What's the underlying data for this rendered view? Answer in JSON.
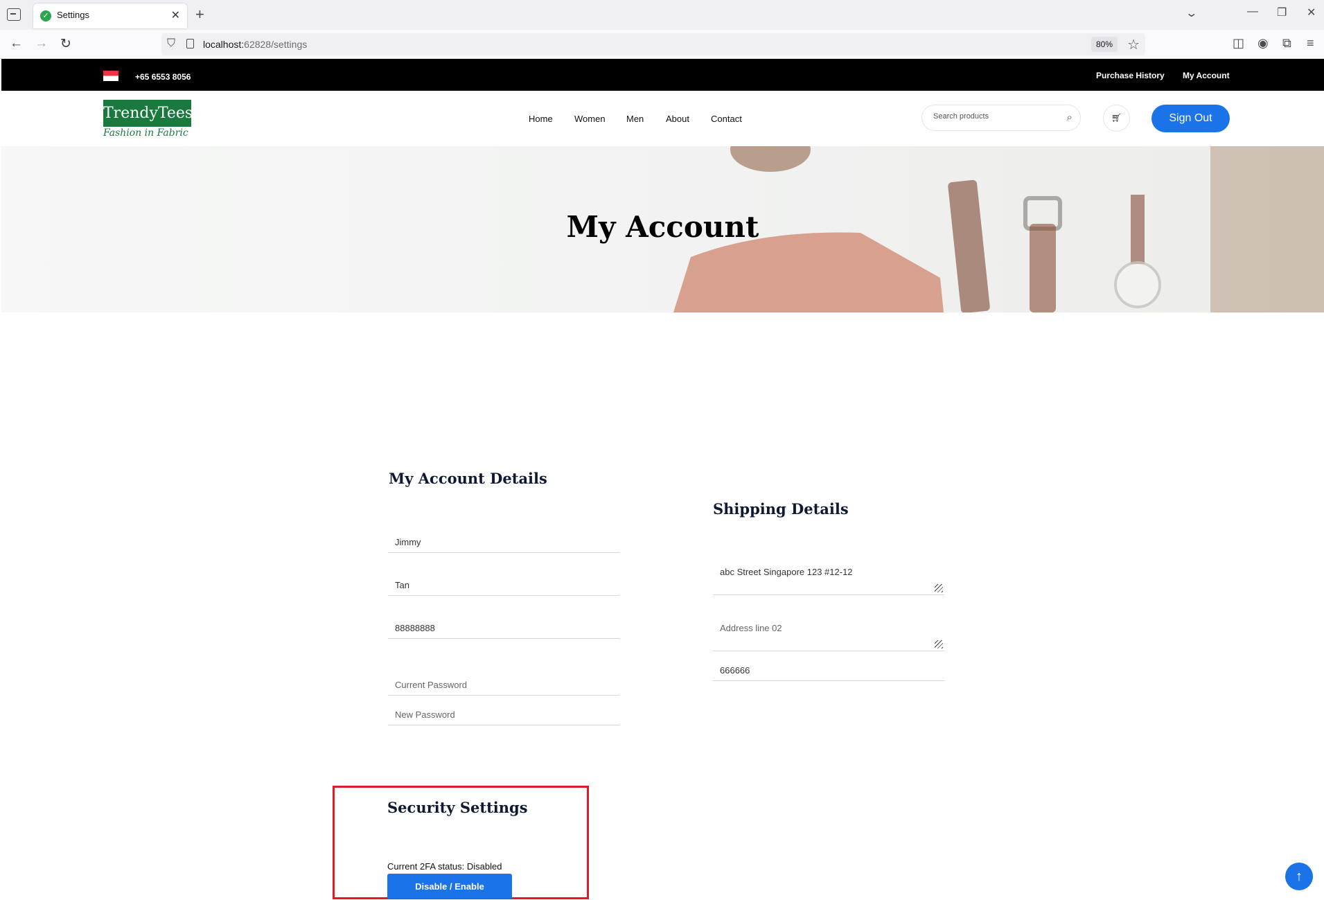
{
  "browser": {
    "tab_title": "Settings",
    "url_host": "localhost:",
    "url_path": "62828/settings",
    "zoom": "80%"
  },
  "topbar": {
    "phone": "+65 6553 8056",
    "links": [
      "Purchase History",
      "My Account"
    ]
  },
  "header": {
    "logo_name": "TrendyTees",
    "logo_tagline": "Fashion in Fabric",
    "menu": [
      "Home",
      "Women",
      "Men",
      "About",
      "Contact"
    ],
    "search_placeholder": "Search products",
    "signout_label": "Sign Out"
  },
  "hero": {
    "title": "My Account"
  },
  "account": {
    "title": "My Account Details",
    "first_name": "Jimmy",
    "last_name": "Tan",
    "phone": "88888888",
    "current_password_placeholder": "Current Password",
    "new_password_placeholder": "New Password"
  },
  "shipping": {
    "title": "Shipping Details",
    "address1": "abc Street Singapore 123 #12-12",
    "address2_placeholder": "Address line 02",
    "postal": "666666"
  },
  "security": {
    "title": "Security Settings",
    "status": "Current 2FA status: Disabled",
    "button_label": "Disable / Enable"
  }
}
